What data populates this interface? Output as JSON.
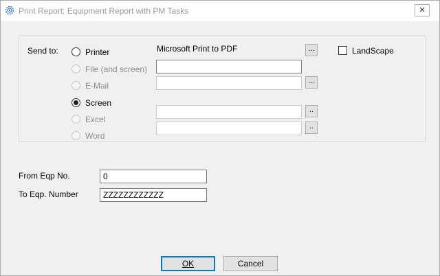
{
  "window": {
    "title": "Print Report: Equipment Report with PM Tasks",
    "close_glyph": "✕"
  },
  "send_to": {
    "label": "Send to:",
    "options": [
      {
        "label": "Printer",
        "selected": false,
        "enabled": true
      },
      {
        "label": "File (and screen)",
        "selected": false,
        "enabled": false
      },
      {
        "label": "E-Mail",
        "selected": false,
        "enabled": false
      },
      {
        "label": "Screen",
        "selected": true,
        "enabled": true
      },
      {
        "label": "Excel",
        "selected": false,
        "enabled": false
      },
      {
        "label": "Word",
        "selected": false,
        "enabled": false
      }
    ],
    "printer_name": "Microsoft Print to PDF",
    "printer_browse": "...",
    "file_path": "",
    "file_browse": "...",
    "email_address": "",
    "email_browse": "...",
    "excel_path": "",
    "excel_browse": "..",
    "word_path": "",
    "word_browse": "..",
    "landscape_label": "LandScape",
    "landscape_checked": false
  },
  "range": {
    "from_label": "From Eqp No.",
    "from_value": "0",
    "to_label": "To Eqp. Number",
    "to_value": "ZZZZZZZZZZZZ"
  },
  "buttons": {
    "ok_label": "OK",
    "cancel_label": "Cancel"
  }
}
